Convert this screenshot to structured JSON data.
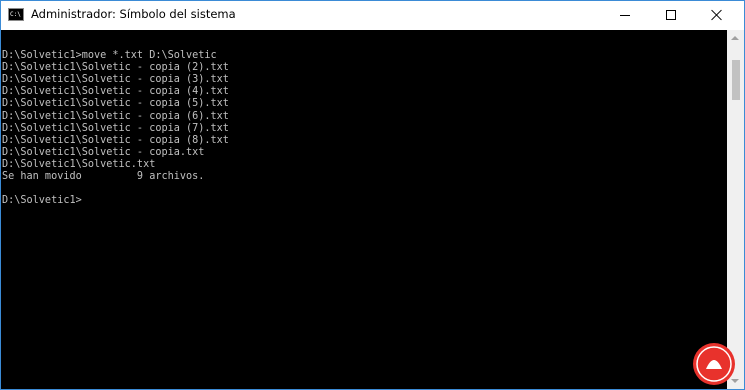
{
  "window": {
    "title": "Administrador: Símbolo del sistema",
    "icon": "cmd-icon",
    "icon_text": "C:\\"
  },
  "controls": {
    "minimize": "minimize-icon",
    "maximize": "maximize-icon",
    "close": "close-icon"
  },
  "console": {
    "lines": [
      "",
      "D:\\Solvetic1>move *.txt D:\\Solvetic",
      "D:\\Solvetic1\\Solvetic - copia (2).txt",
      "D:\\Solvetic1\\Solvetic - copia (3).txt",
      "D:\\Solvetic1\\Solvetic - copia (4).txt",
      "D:\\Solvetic1\\Solvetic - copia (5).txt",
      "D:\\Solvetic1\\Solvetic - copia (6).txt",
      "D:\\Solvetic1\\Solvetic - copia (7).txt",
      "D:\\Solvetic1\\Solvetic - copia (8).txt",
      "D:\\Solvetic1\\Solvetic - copia.txt",
      "D:\\Solvetic1\\Solvetic.txt",
      "Se han movido         9 archivos.",
      "",
      "D:\\Solvetic1>"
    ],
    "text_color": "#c0c0c0",
    "background": "#000000"
  },
  "colors": {
    "border": "#3b8bd6",
    "watermark": "#e8322c"
  }
}
